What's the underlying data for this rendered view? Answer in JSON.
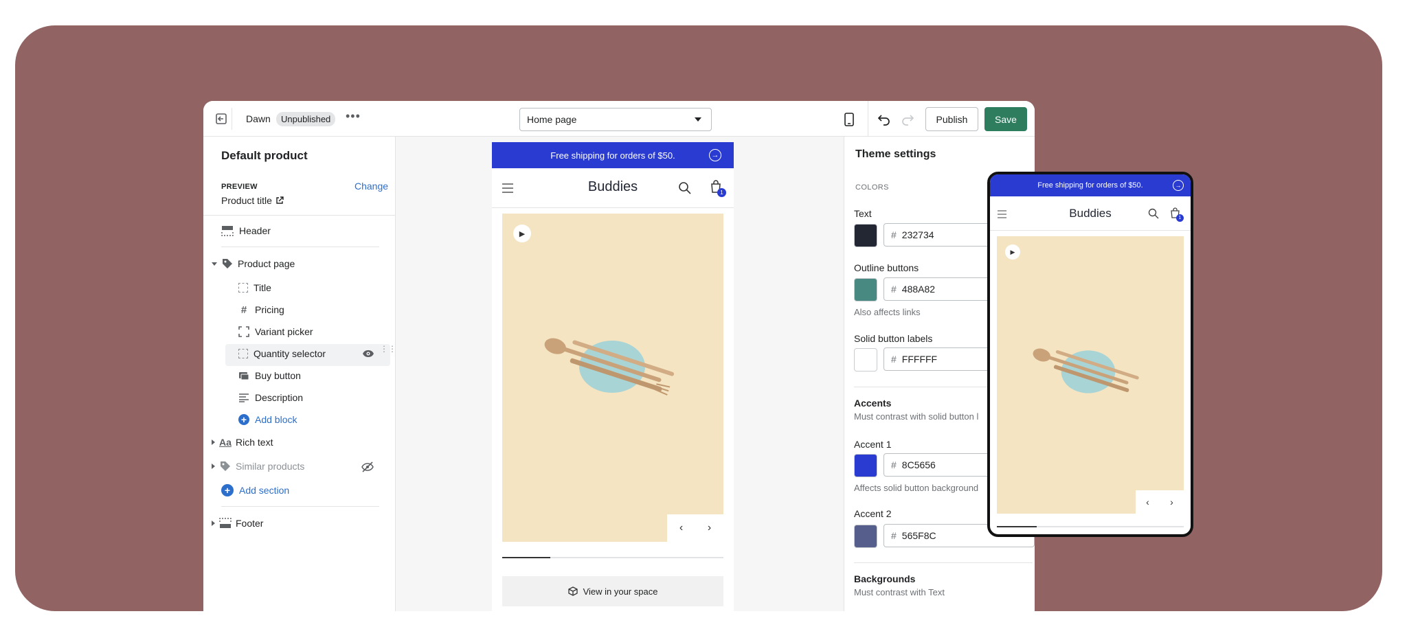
{
  "colors": {
    "bg": "#926363",
    "accent_bar": "#2a3bd2",
    "save": "#2d7d5e",
    "product_bg": "#f4e4c1"
  },
  "topbar": {
    "theme_name": "Dawn",
    "status": "Unpublished",
    "page_select": "Home page",
    "publish": "Publish",
    "save": "Save"
  },
  "sidebar": {
    "title": "Default product",
    "preview_label": "PREVIEW",
    "preview_value": "Product title",
    "change": "Change",
    "header": "Header",
    "product_page": "Product page",
    "blocks": [
      {
        "label": "Title",
        "icon": "title-icon"
      },
      {
        "label": "Pricing",
        "icon": "hash-icon"
      },
      {
        "label": "Variant picker",
        "icon": "variant-icon"
      },
      {
        "label": "Quantity selector",
        "icon": "quantity-icon"
      },
      {
        "label": "Buy button",
        "icon": "buy-icon"
      },
      {
        "label": "Description",
        "icon": "description-icon"
      }
    ],
    "add_block": "Add block",
    "rich_text": "Rich text",
    "similar_products": "Similar products",
    "add_section": "Add section",
    "footer": "Footer"
  },
  "preview": {
    "announcement": "Free shipping for orders of $50.",
    "store_name": "Buddies",
    "cart_count": "1",
    "view_in_space": "View in your space"
  },
  "theme": {
    "title": "Theme settings",
    "colors_heading": "COLORS",
    "text_label": "Text",
    "text_hash": "#",
    "text_value": "232734",
    "text_color": "#232734",
    "outline_label": "Outline buttons",
    "outline_hash": "#",
    "outline_value": "488A82",
    "outline_color": "#488a82",
    "outline_help": "Also affects links",
    "solid_label": "Solid button labels",
    "solid_hash": "#",
    "solid_value": "FFFFFF",
    "solid_color": "#ffffff",
    "accents": "Accents",
    "accents_help": "Must contrast with solid button l",
    "accent1_label": "Accent 1",
    "accent1_hash": "#",
    "accent1_value": "8C5656",
    "accent1_color": "#2a3bd2",
    "accent1_help": "Affects solid button background",
    "accent2_label": "Accent 2",
    "accent2_hash": "#",
    "accent2_value": "565F8C",
    "accent2_color": "#565f8c",
    "backgrounds": "Backgrounds",
    "backgrounds_help": "Must contrast with Text"
  },
  "mobile": {
    "announcement": "Free shipping for orders of $50.",
    "store_name": "Buddies",
    "cart_count": "1"
  }
}
